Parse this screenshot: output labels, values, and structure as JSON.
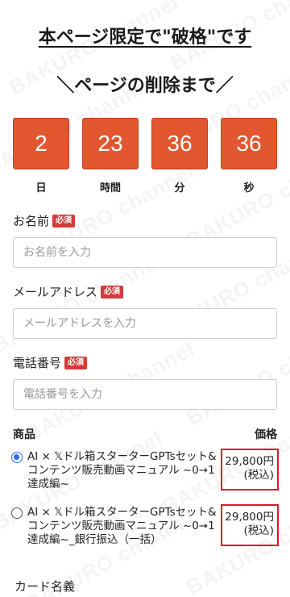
{
  "headline": "本ページ限定で\"破格\"です",
  "countdown_title": "＼ページの削除まで／",
  "countdown": [
    {
      "value": "2",
      "unit": "日"
    },
    {
      "value": "23",
      "unit": "時間"
    },
    {
      "value": "36",
      "unit": "分"
    },
    {
      "value": "36",
      "unit": "秒"
    }
  ],
  "form": {
    "required_badge": "必須",
    "name": {
      "label": "お名前",
      "placeholder": "お名前を入力"
    },
    "email": {
      "label": "メールアドレス",
      "placeholder": "メールアドレスを入力"
    },
    "phone": {
      "label": "電話番号",
      "placeholder": "電話番号を入力"
    }
  },
  "products": {
    "col_product": "商品",
    "col_price": "価格",
    "items": [
      {
        "name": "AI × 𝕏ドル箱スターターGPTsセット&コンテンツ販売動画マニュアル ~0→1達成編~",
        "price": "29,800円",
        "tax": "(税込)",
        "selected": true
      },
      {
        "name": "AI × 𝕏ドル箱スターターGPTsセット&コンテンツ販売動画マニュアル ~0→1達成編~_銀行振込（一括）",
        "price": "29,800円",
        "tax": "(税込)",
        "selected": false
      }
    ]
  },
  "card_holder_label": "カード名義",
  "watermark": "BAKURO channel"
}
